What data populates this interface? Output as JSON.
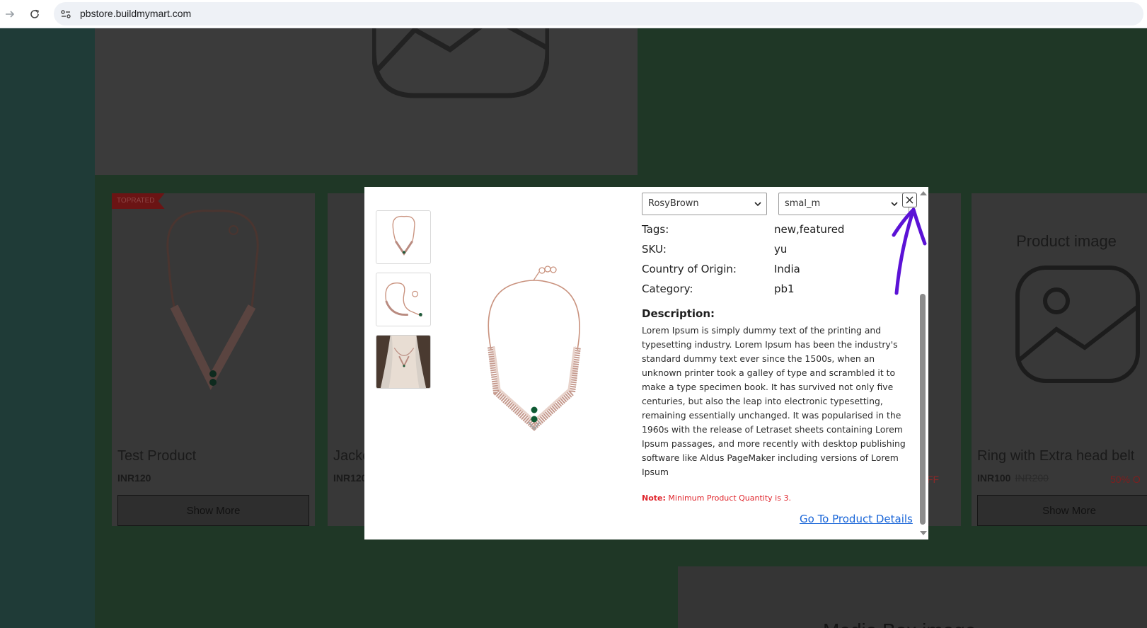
{
  "browser": {
    "url": "pbstore.buildmymart.com"
  },
  "background_page": {
    "cards": [
      {
        "badge": "TOPRATED",
        "title": "Test Product",
        "price": "INR120",
        "button": "Show More"
      },
      {
        "title": "Jacke",
        "price": "INR120"
      },
      {
        "discount_fragment": "FF"
      },
      {
        "image_placeholder": "Product image",
        "title": "Ring with Extra head belt",
        "price": "INR100",
        "old_price": "INR200",
        "discount": "50% O",
        "button": "Show More"
      }
    ],
    "bottom_caption": "Media Box image"
  },
  "modal": {
    "selects": {
      "color": "RosyBrown",
      "size": "smal_m"
    },
    "specs": [
      {
        "label": "Tags:",
        "value": "new,featured"
      },
      {
        "label": "SKU:",
        "value": "yu"
      },
      {
        "label": "Country of Origin:",
        "value": "India"
      },
      {
        "label": "Category:",
        "value": "pb1"
      }
    ],
    "description_title": "Description:",
    "description": "Lorem Ipsum is simply dummy text of the printing and typesetting industry. Lorem Ipsum has been the industry's standard dummy text ever since the 1500s, when an unknown printer took a galley of type and scrambled it to make a type specimen book. It has survived not only five centuries, but also the leap into electronic typesetting, remaining essentially unchanged. It was popularised in the 1960s with the release of Letraset sheets containing Lorem Ipsum passages, and more recently with desktop publishing software like Aldus PageMaker including versions of Lorem Ipsum",
    "note_label": "Note:",
    "note_text": "Minimum Product Quantity is 3.",
    "link": "Go To Product Details"
  },
  "colors": {
    "link": "#1a66d8",
    "note": "#e0252c",
    "annotation": "#5b12d6"
  }
}
